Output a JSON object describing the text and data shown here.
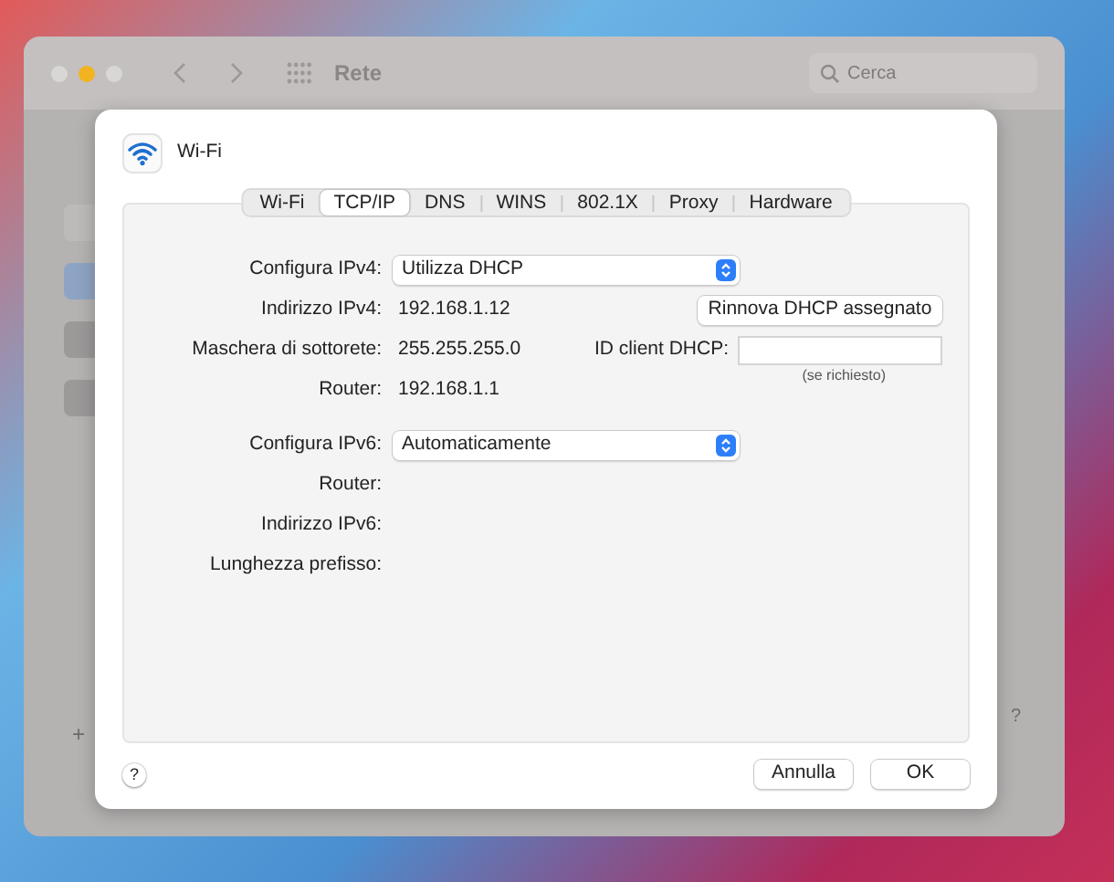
{
  "window": {
    "title": "Rete",
    "search": {
      "placeholder": "Cerca"
    },
    "help": "?",
    "add": "+"
  },
  "sheet": {
    "title": "Wi-Fi",
    "tabs": [
      {
        "label": "Wi-Fi",
        "selected": false
      },
      {
        "label": "TCP/IP",
        "selected": true
      },
      {
        "label": "DNS",
        "selected": false
      },
      {
        "label": "WINS",
        "selected": false
      },
      {
        "label": "802.1X",
        "selected": false
      },
      {
        "label": "Proxy",
        "selected": false
      },
      {
        "label": "Hardware",
        "selected": false
      }
    ],
    "ipv4": [
      {
        "kind": "popup",
        "label": "Configura IPv4:",
        "value": "Utilizza DHCP"
      },
      {
        "kind": "text",
        "label": "Indirizzo IPv4:",
        "value": "192.168.1.12"
      },
      {
        "kind": "text",
        "label": "Maschera di sottorete:",
        "value": "255.255.255.0"
      },
      {
        "kind": "text",
        "label": "Router:",
        "value": "192.168.1.1"
      }
    ],
    "renew_button": "Rinnova DHCP assegnato",
    "dhcp_client_id": {
      "label": "ID client DHCP:",
      "hint": "(se richiesto)"
    },
    "ipv6": [
      {
        "kind": "popup",
        "label": "Configura IPv6:",
        "value": "Automaticamente"
      },
      {
        "kind": "text",
        "label": "Router:"
      },
      {
        "kind": "text",
        "label": "Indirizzo IPv6:"
      },
      {
        "kind": "text",
        "label": "Lunghezza prefisso:"
      }
    ],
    "help": "?",
    "buttons": [
      "Annulla",
      "OK"
    ]
  }
}
